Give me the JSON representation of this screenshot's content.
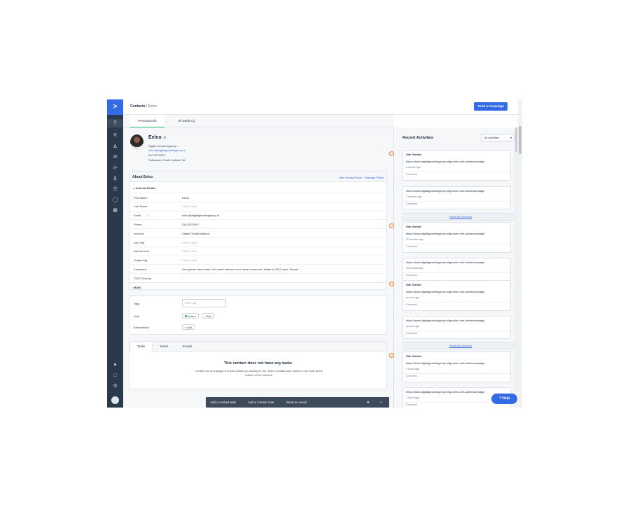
{
  "nav": {
    "logo": ">",
    "icons": [
      "search-icon",
      "location-icon",
      "contacts-icon",
      "mail-icon",
      "automation-icon",
      "deals-icon",
      "lists-icon",
      "conversations-icon",
      "reports-icon",
      "heart-icon",
      "pages-icon",
      "settings-icon",
      "account-icon"
    ]
  },
  "header": {
    "breadcrumb_root": "Contacts",
    "breadcrumb_sep": "/",
    "breadcrumb_current": "Eelco",
    "send_campaign": "Send a Campaign"
  },
  "tabs": {
    "personal_info": "Personal Info",
    "all_deals": "All Deals (1)"
  },
  "contact": {
    "name": "Eelco",
    "company": "Digital Growth Agency",
    "email": "eelco@digitalgrowthagency.nl",
    "phone": "010-3070303",
    "location": "Rotterdam, South Holland, NL"
  },
  "about": {
    "title": "About Eelco",
    "hide_empty": "Hide Empty Fields",
    "separator": "|",
    "manage": "Manage Fields",
    "section_general": "General Details",
    "section_bant": "BANT",
    "fields": [
      {
        "label": "First Name",
        "value": "Eelco",
        "placeholder": false
      },
      {
        "label": "Last Name",
        "value": "Click to add",
        "placeholder": true
      },
      {
        "label": "Email",
        "value": "eelco@digitalgrowthagency.nl",
        "placeholder": false
      },
      {
        "label": "Phone",
        "value": "010-3070303",
        "placeholder": false
      },
      {
        "label": "Account",
        "value": "Digital Growth Agency",
        "placeholder": false
      },
      {
        "label": "Job Title",
        "value": "Click to add",
        "placeholder": true
      },
      {
        "label": "Internal Link",
        "value": "Click to add",
        "placeholder": true
      },
      {
        "label": "Verjaardag",
        "value": "Click to add",
        "placeholder": true
      },
      {
        "label": "Kerstwens",
        "value": "Veel plezier deze kerst. Het wordt vast een mooi feest en we zien elkaar in 2022 weer. Proost!",
        "placeholder": false
      },
      {
        "label": "TEST Scoring",
        "value": "---",
        "placeholder": true
      }
    ]
  },
  "meta": {
    "tags_label": "Tags",
    "tags_placeholder": "Enter tag",
    "lists_label": "Lists",
    "list_name": "Eelsen",
    "add": "+ Add",
    "automations_label": "Automations"
  },
  "tasks": {
    "tabs": [
      "Tasks",
      "Notes",
      "Emails"
    ],
    "empty_title": "This contact does not have any tasks",
    "empty_text": "Create one and assign it to this contact by clicking on the \"Add a contact task\" button in the dock at the bottom of the screens."
  },
  "dock": {
    "add_task": "Add a contact task",
    "add_note": "Add a contact note",
    "send_email": "Send an email"
  },
  "activities": {
    "title": "Recent Activities",
    "filter": "All Activities",
    "show_all_3": "Show All 3 Events",
    "show_all_4": "Show All 4 Events",
    "site_visited": "Site Visited",
    "url": "https://www.digitalgrowthagency.nl/groeien-met-activecampaign",
    "comment": "Comment",
    "times": [
      "a minute ago",
      "3 minutes ago",
      "22 minutes ago",
      "25 minutes ago",
      "an hour ago",
      "an hour ago",
      "2 hours ago",
      "3 hours ago"
    ]
  },
  "help": "? Help",
  "colors": {
    "brand": "#356ae6",
    "accent_green": "#1db373",
    "sidebar": "#2b3a4a",
    "activity_marker": "#f0803c"
  }
}
